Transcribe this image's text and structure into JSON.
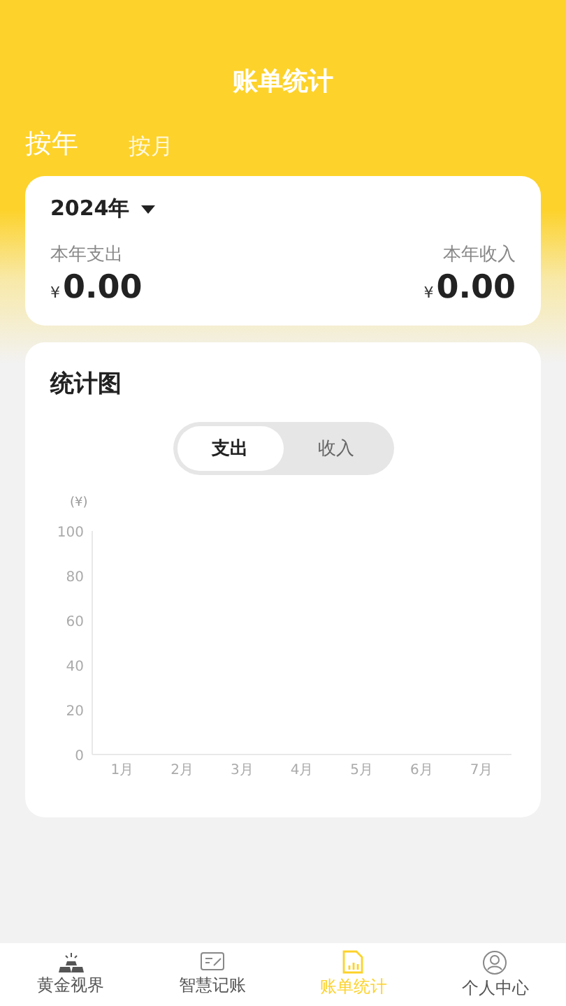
{
  "header": {
    "title": "账单统计"
  },
  "period_tabs": [
    {
      "label": "按年",
      "selected": true
    },
    {
      "label": "按月",
      "selected": false
    }
  ],
  "summary": {
    "year": "2024年",
    "expense_label": "本年支出",
    "expense_currency": "¥",
    "expense": "0.00",
    "income_label": "本年收入",
    "income_currency": "¥",
    "income": "0.00"
  },
  "chart_card": {
    "title": "统计图",
    "toggle": [
      {
        "label": "支出",
        "selected": true
      },
      {
        "label": "收入",
        "selected": false
      }
    ],
    "unit": "(¥)",
    "chart_data": {
      "type": "bar",
      "categories": [
        "1月",
        "2月",
        "3月",
        "4月",
        "5月",
        "6月",
        "7月"
      ],
      "values": [
        null,
        null,
        null,
        null,
        null,
        null,
        null
      ],
      "ylim": [
        0,
        100
      ],
      "yticks": [
        0,
        20,
        40,
        60,
        80,
        100
      ]
    }
  },
  "bottom_nav": [
    {
      "kind": "gold",
      "label": "黄金视界",
      "selected": false
    },
    {
      "kind": "note",
      "label": "智慧记账",
      "selected": false
    },
    {
      "kind": "stats",
      "label": "账单统计",
      "selected": true
    },
    {
      "kind": "user",
      "label": "个人中心",
      "selected": false
    }
  ]
}
